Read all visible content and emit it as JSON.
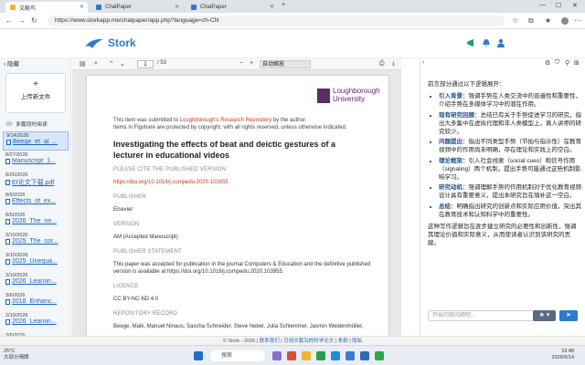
{
  "browser": {
    "tabs": [
      {
        "label": "文献鸟",
        "color": "#f2b233"
      },
      {
        "label": "ChatPaper",
        "color": "#2c7bd2"
      },
      {
        "label": "ChatPaper",
        "color": "#2c7bd2"
      }
    ],
    "url": "https://www.storkapp.me/chatpaper/app.php?language=zh-CN"
  },
  "app": {
    "name": "Stork",
    "brand_color": "#2c7bd2"
  },
  "sidebar": {
    "hide_label": "隐藏",
    "upload_label": "上传新文件",
    "multi_read_label": "多篇同时阅读",
    "files": [
      {
        "date": "9/14/2026",
        "name": "Beege_et_al_...",
        "selected": true
      },
      {
        "date": "8/27/2026",
        "name": "Manuscript_1..."
      },
      {
        "date": "8/25/2026",
        "name": "EI论文下载.pdf"
      },
      {
        "date": "8/6/2026",
        "name": "Effects_of_ex..."
      },
      {
        "date": "8/5/2026",
        "name": "2026_The_ne..."
      },
      {
        "date": "3/10/2026",
        "name": "2025_The_cor..."
      },
      {
        "date": "3/10/2026",
        "name": "2025_Unequa..."
      },
      {
        "date": "3/10/2026",
        "name": "2026_Learnin..."
      },
      {
        "date": "3/6/2026",
        "name": "2018_Enhanc..."
      },
      {
        "date": "2/10/2026",
        "name": "2026_Learnin..."
      },
      {
        "date": "2/6/2026",
        "name": ""
      }
    ]
  },
  "pdf_toolbar": {
    "page_current": "1",
    "page_total": "/ 53",
    "zoom": "自动缩放"
  },
  "pdf": {
    "university_line1": "Loughborough",
    "university_line2": "University",
    "submitted_prefix": "This item was submitted to ",
    "repository_link": "Loughborough's Research Repository",
    "submitted_suffix": " by the author.",
    "copyright": "Items in Figshare are protected by copyright, with all rights reserved, unless otherwise indicated.",
    "title": "Investigating the effects of beat and deictic gestures of a lecturer in educational videos",
    "cite_heading": "PLEASE CITE THE PUBLISHED VERSION",
    "doi": "https://doi.org/10.1016/j.compedu.2020.103955",
    "publisher_heading": "PUBLISHER",
    "publisher": "Elsevier",
    "version_heading": "VERSION",
    "version": "AM (Accepted Manuscript)",
    "statement_heading": "PUBLISHER STATEMENT",
    "statement": "This paper was accepted for publication in the journal Computers & Education and the definitive published version is available at https://doi.org/10.1016/j.compedu.2020.103955.",
    "licence_heading": "LICENCE",
    "licence": "CC BY-NC-ND 4.0",
    "record_heading": "REPOSITORY RECORD",
    "record": "Beege, Maik, Manuel Ninaus, Sascha Schneider, Steve Nebel, Julia Schlemmel, Jasmin Weidenmüller,"
  },
  "summary": {
    "intro": "前言部分通过以下逻辑展开：",
    "items": [
      {
        "term": "引入背景",
        "text": "：强调手势在人类交流中的普遍性和重要性，介绍手势在多媒体学习中的潜在作用。"
      },
      {
        "term": "现有研究回顾",
        "text": "：总结已有关于手势促进学习的研究，指出大多集中在虚拟代理和非人类模型上，真人讲师的研究较少。"
      },
      {
        "term": "问题提出",
        "text": "：指出不同类型手势（节拍与指示性）在教育视频中的作用尚未明确，存在理论和实践上的空白。"
      },
      {
        "term": "理论框架",
        "text": "：引入社会线索（social cues）和信号作用（signaling）两个机制，提出手势可能通过这些机制影响学习。"
      },
      {
        "term": "研究动机",
        "text": "：强调理解手势的作用机制对于优化教育视频设计具有重要意义，提出本研究旨在填补这一空白。"
      },
      {
        "term": "总结",
        "text": "：明确指出研究的创新点和实际应用价值，突出其在教育技术和认知科学中的重要性。"
      }
    ],
    "footer": "这种写作逻辑旨在逐步建立研究的必要性和创新性，强调其理论价值和实际意义，从而使读者认识到该研究的贡献。"
  },
  "chat": {
    "placeholder": "开始问我问题吧...",
    "star_label": "★ ▾",
    "send_label": "➤"
  },
  "footer": {
    "prefix": "© Stork - 2026 | ",
    "links": [
      "联系我们",
      "引用文献鸟的科学论文",
      "条款",
      "隐私"
    ]
  },
  "taskbar": {
    "temperature": "25°C",
    "weather": "大部分晴朗",
    "search": "搜索",
    "time": "19:48",
    "date": "2026/9/14"
  }
}
